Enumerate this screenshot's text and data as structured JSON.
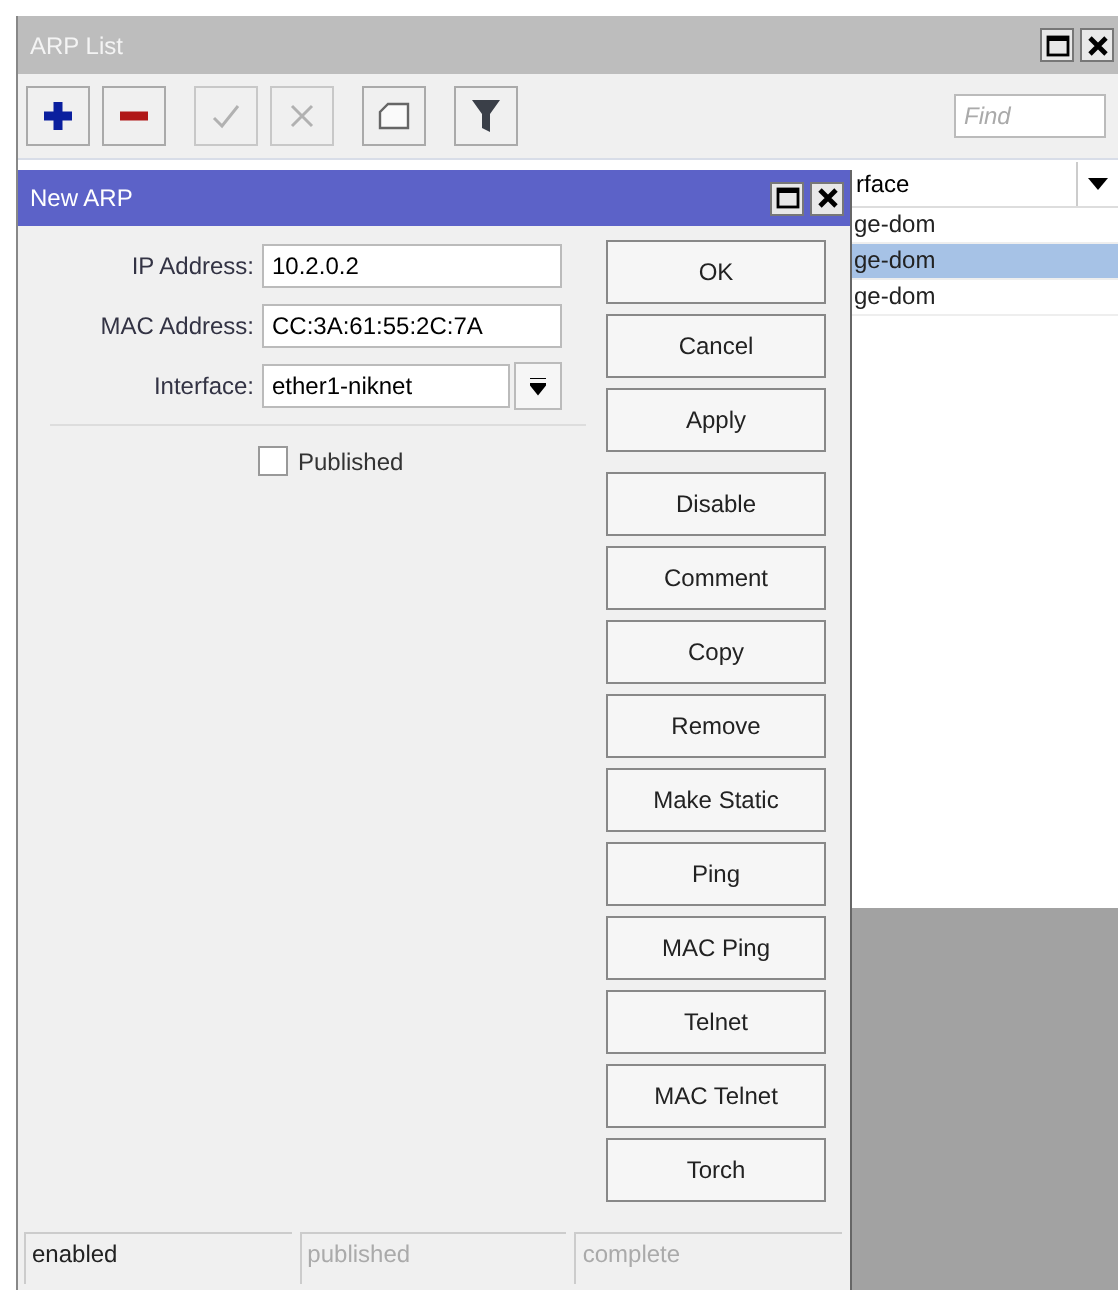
{
  "window": {
    "title": "ARP List"
  },
  "toolbar": [
    {
      "kind": "plus",
      "disabled": false
    },
    {
      "kind": "minus",
      "disabled": false
    },
    {
      "kind": "check",
      "disabled": true
    },
    {
      "kind": "cross",
      "disabled": true
    },
    {
      "kind": "note",
      "disabled": false
    },
    {
      "kind": "filter",
      "disabled": false
    }
  ],
  "search": {
    "placeholder": "Find"
  },
  "table": {
    "columns": [
      "rface"
    ],
    "rows": [
      {
        "cells": [
          "ge-dom"
        ],
        "selected": false
      },
      {
        "cells": [
          "ge-dom"
        ],
        "selected": true
      },
      {
        "cells": [
          "ge-dom"
        ],
        "selected": false
      }
    ]
  },
  "dialog": {
    "title": "New ARP",
    "fields": [
      {
        "label": "IP Address:",
        "value": "10.2.0.2",
        "kind": "text"
      },
      {
        "label": "MAC Address:",
        "value": "CC:3A:61:55:2C:7A",
        "kind": "text"
      },
      {
        "label": "Interface:",
        "value": "ether1-niknet",
        "kind": "dropdown"
      }
    ],
    "checkbox": {
      "label": "Published",
      "checked": false
    },
    "buttons": [
      "OK",
      "Cancel",
      "Apply",
      "Disable",
      "Comment",
      "Copy",
      "Remove",
      "Make Static",
      "Ping",
      "MAC Ping",
      "Telnet",
      "MAC Telnet",
      "Torch"
    ],
    "status_bar": [
      {
        "text": "enabled",
        "dimmed": false
      },
      {
        "text": "published",
        "dimmed": true
      },
      {
        "text": "complete",
        "dimmed": true
      }
    ]
  }
}
